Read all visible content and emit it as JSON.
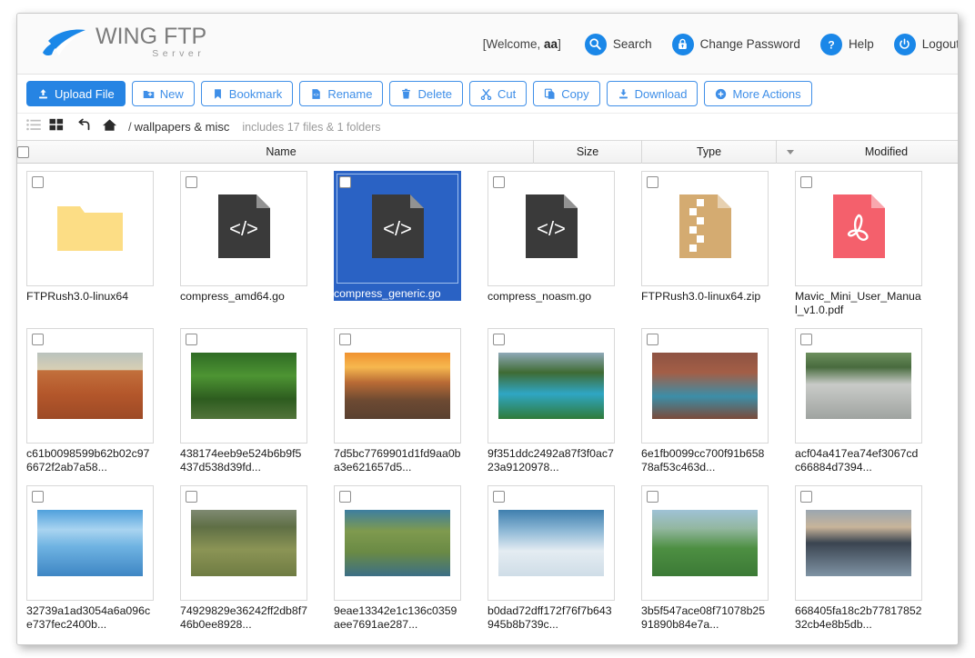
{
  "header": {
    "logo_main": "WING FTP",
    "logo_sub": "Server",
    "welcome_prefix": "[Welcome, ",
    "welcome_user": "aa",
    "welcome_suffix": "]",
    "links": [
      {
        "label": "Search",
        "icon": "search-icon"
      },
      {
        "label": "Change Password",
        "icon": "lock-icon"
      },
      {
        "label": "Help",
        "icon": "question-icon"
      },
      {
        "label": "Logout",
        "icon": "power-icon"
      }
    ],
    "accent_color": "#1a87e8"
  },
  "toolbar": {
    "buttons": [
      {
        "label": "Upload File",
        "icon": "upload-icon",
        "primary": true
      },
      {
        "label": "New",
        "icon": "new-folder-icon",
        "primary": false
      },
      {
        "label": "Bookmark",
        "icon": "bookmark-icon",
        "primary": false
      },
      {
        "label": "Rename",
        "icon": "rename-file-icon",
        "primary": false
      },
      {
        "label": "Delete",
        "icon": "trash-icon",
        "primary": false
      },
      {
        "label": "Cut",
        "icon": "scissors-icon",
        "primary": false
      },
      {
        "label": "Copy",
        "icon": "copy-icon",
        "primary": false
      },
      {
        "label": "Download",
        "icon": "download-icon",
        "primary": false
      },
      {
        "label": "More Actions",
        "icon": "plus-circle-icon",
        "primary": false
      }
    ],
    "primary_color": "#2684e3",
    "outline_color": "#3f8fe8"
  },
  "pathbar": {
    "separator": "/",
    "current_folder": "wallpapers & misc",
    "summary": "includes 17 files & 1 folders"
  },
  "columns": {
    "name": "Name",
    "size": "Size",
    "type": "Type",
    "modified": "Modified"
  },
  "files": [
    {
      "name": "FTPRush3.0-linux64",
      "kind": "folder",
      "selected": false
    },
    {
      "name": "compress_amd64.go",
      "kind": "code",
      "selected": false
    },
    {
      "name": "compress_generic.go",
      "kind": "code",
      "selected": true
    },
    {
      "name": "compress_noasm.go",
      "kind": "code",
      "selected": false
    },
    {
      "name": "FTPRush3.0-linux64.zip",
      "kind": "zip",
      "selected": false
    },
    {
      "name": "Mavic_Mini_User_Manual_v1.0.pdf",
      "kind": "pdf",
      "selected": false
    },
    {
      "name": "c61b0098599b62b02c976672f2ab7a58...",
      "kind": "image",
      "thumb": "desert-dune",
      "selected": false
    },
    {
      "name": "438174eeb9e524b6b9f5437d538d39fd...",
      "kind": "image",
      "thumb": "rainforest-path",
      "selected": false
    },
    {
      "name": "7d5bc7769901d1fd9aa0ba3e621657d5...",
      "kind": "image",
      "thumb": "sunset-ridge",
      "selected": false
    },
    {
      "name": "9f351ddc2492a87f3f0ac723a9120978...",
      "kind": "image",
      "thumb": "turquoise-river",
      "selected": false
    },
    {
      "name": "6e1fb0099cc700f91b65878af53c463d...",
      "kind": "image",
      "thumb": "canyon-waterfall",
      "selected": false
    },
    {
      "name": "acf04a417ea74ef3067cdc66884d7394...",
      "kind": "image",
      "thumb": "wide-falls",
      "selected": false
    },
    {
      "name": "32739a1ad3054a6a096ce737fec2400b...",
      "kind": "image",
      "thumb": "lake-bridge",
      "selected": false
    },
    {
      "name": "74929829e36242ff2db8f746b0ee8928...",
      "kind": "image",
      "thumb": "moss-cottage",
      "selected": false
    },
    {
      "name": "9eae13342e1c136c0359aee7691ae287...",
      "kind": "image",
      "thumb": "coastal-fields",
      "selected": false
    },
    {
      "name": "b0dad72dff172f76f7b643945b8b739c...",
      "kind": "image",
      "thumb": "snow-haybale",
      "selected": false
    },
    {
      "name": "3b5f547ace08f71078b2591890b84e7a...",
      "kind": "image",
      "thumb": "green-hill",
      "selected": false
    },
    {
      "name": "668405fa18c2b7781785232cb4e8b5db...",
      "kind": "image",
      "thumb": "sea-rocks",
      "selected": false
    }
  ],
  "icon_colors": {
    "folder": "#fcdd85",
    "code_doc": "#3a3a3a",
    "zip_doc": "#d4ab71",
    "pdf_doc": "#f4606c",
    "selection_blue": "#2a62c4"
  }
}
